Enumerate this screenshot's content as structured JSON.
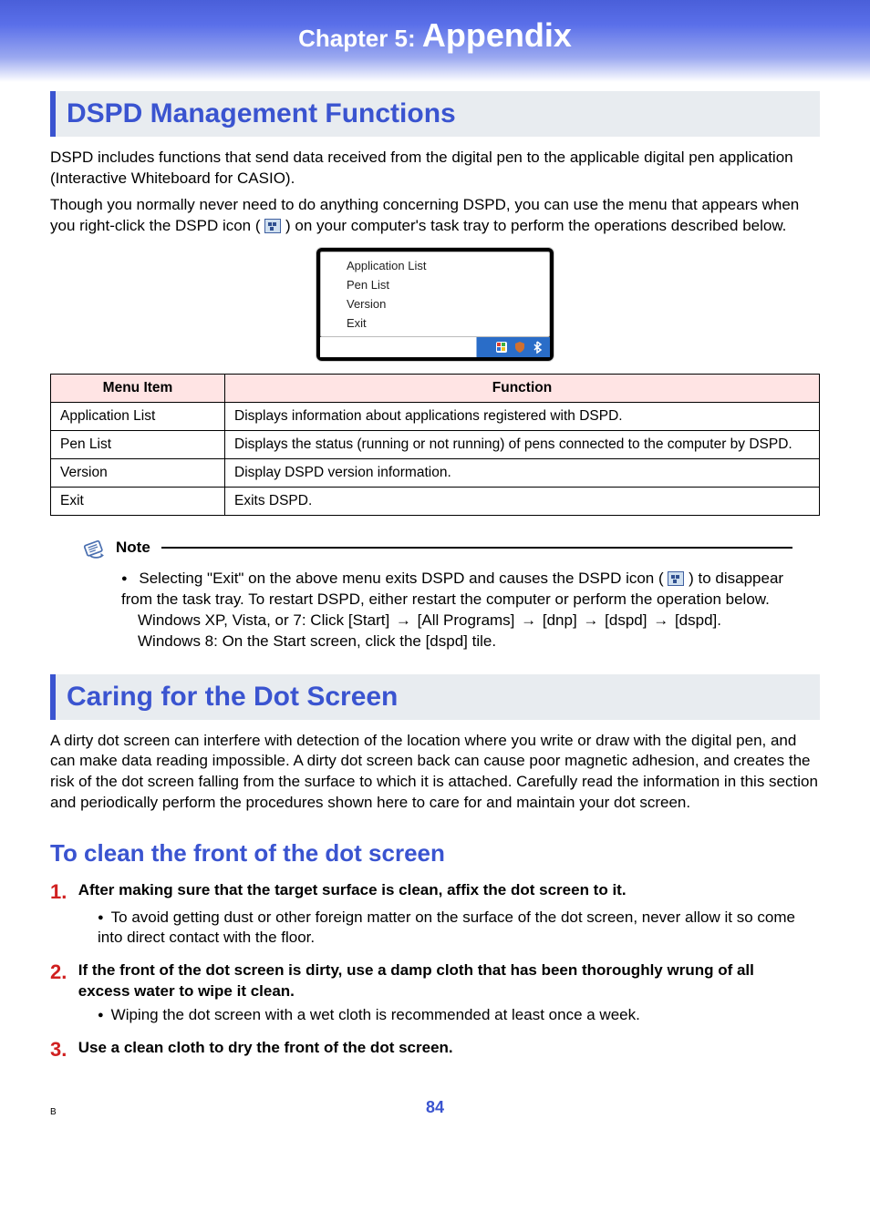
{
  "chapter": {
    "prefix": "Chapter 5: ",
    "title": "Appendix"
  },
  "section1": {
    "title": "DSPD Management Functions",
    "para1a": "DSPD includes functions that send data received from the digital pen to the applicable digital pen application (Interactive Whiteboard for CASIO).",
    "para1b_before": "Though you normally never need to do anything concerning DSPD, you can use the menu that appears when you right-click the DSPD icon (",
    "para1b_after": ") on your computer's task tray to perform the operations described below."
  },
  "context_menu": {
    "items": [
      "Application List",
      "Pen List",
      "Version",
      "Exit"
    ]
  },
  "table": {
    "headers": [
      "Menu Item",
      "Function"
    ],
    "rows": [
      {
        "item": "Application List",
        "func": "Displays information about applications registered with DSPD."
      },
      {
        "item": "Pen List",
        "func": "Displays the status (running or not running) of pens connected to the computer by DSPD."
      },
      {
        "item": "Version",
        "func": "Display DSPD version information."
      },
      {
        "item": "Exit",
        "func": "Exits DSPD."
      }
    ]
  },
  "note": {
    "label": "Note",
    "bullet_before": "Selecting \"Exit\" on the above menu exits DSPD and causes the DSPD icon (",
    "bullet_after": ") to disappear from the task tray. To restart DSPD, either restart the computer or perform the operation below.",
    "nav_prefix": "Windows XP, Vista, or 7: Click [Start] ",
    "nav_parts": [
      "[All Programs]",
      "[dnp]",
      "[dspd]",
      "[dspd]."
    ],
    "win8": "Windows 8: On the Start screen, click the [dspd] tile."
  },
  "section2": {
    "title": "Caring for the Dot Screen",
    "para": "A dirty dot screen can interfere with detection of the location where you write or draw with the digital pen, and can make data reading impossible. A dirty dot screen back can cause poor magnetic adhesion, and creates the risk of the dot screen falling from the surface to which it is attached. Carefully read the information in this section and periodically perform the procedures shown here to care for and maintain your dot screen."
  },
  "subsection": {
    "title": "To clean the front of the dot screen",
    "steps": [
      {
        "num": "1.",
        "head": "After making sure that the target surface is clean, affix the dot screen to it.",
        "body": "To avoid getting dust or other foreign matter on the surface of the dot screen, never allow it so come into direct contact with the floor."
      },
      {
        "num": "2.",
        "head": "If the front of the dot screen is dirty, use a damp cloth that has been thoroughly wrung of all excess water to wipe it clean.",
        "body": "Wiping the dot screen with a wet cloth is recommended at least once a week."
      },
      {
        "num": "3.",
        "head": "Use a clean cloth to dry the front of the dot screen.",
        "body": ""
      }
    ]
  },
  "footer": {
    "page": "84",
    "mark": "B"
  }
}
